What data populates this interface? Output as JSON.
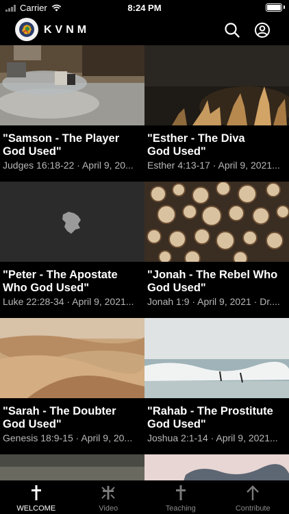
{
  "status_bar": {
    "carrier": "Carrier",
    "time": "8:24 PM"
  },
  "header": {
    "brand": "KVNM"
  },
  "sermons": [
    {
      "title_line1": "\"Samson - The Player",
      "title_line2": "God Used\"",
      "meta": "Judges 16:18-22 · April 9, 20..."
    },
    {
      "title_line1": "\"Esther - The Diva",
      "title_line2": "God Used\"",
      "meta": "Esther 4:13-17 · April 9, 2021..."
    },
    {
      "title_line1": "\"Peter - The Apostate",
      "title_line2": "Who God Used\"",
      "meta": "Luke 22:28-34 · April 9, 2021..."
    },
    {
      "title_line1": "\"Jonah - The Rebel Who",
      "title_line2": "God Used\"",
      "meta": "Jonah 1:9 · April 9, 2021 · Dr...."
    },
    {
      "title_line1": "\"Sarah - The Doubter",
      "title_line2": "God Used\"",
      "meta": "Genesis 18:9-15 · April 9, 20..."
    },
    {
      "title_line1": "\"Rahab - The Prostitute",
      "title_line2": "God Used\"",
      "meta": "Joshua 2:1-14 · April 9, 2021..."
    }
  ],
  "tabs": [
    {
      "label": "WELCOME",
      "icon": "cross-icon"
    },
    {
      "label": "Video",
      "icon": "video-icon"
    },
    {
      "label": "Teaching",
      "icon": "cross-icon"
    },
    {
      "label": "Contribute",
      "icon": "arrow-up-icon"
    }
  ]
}
